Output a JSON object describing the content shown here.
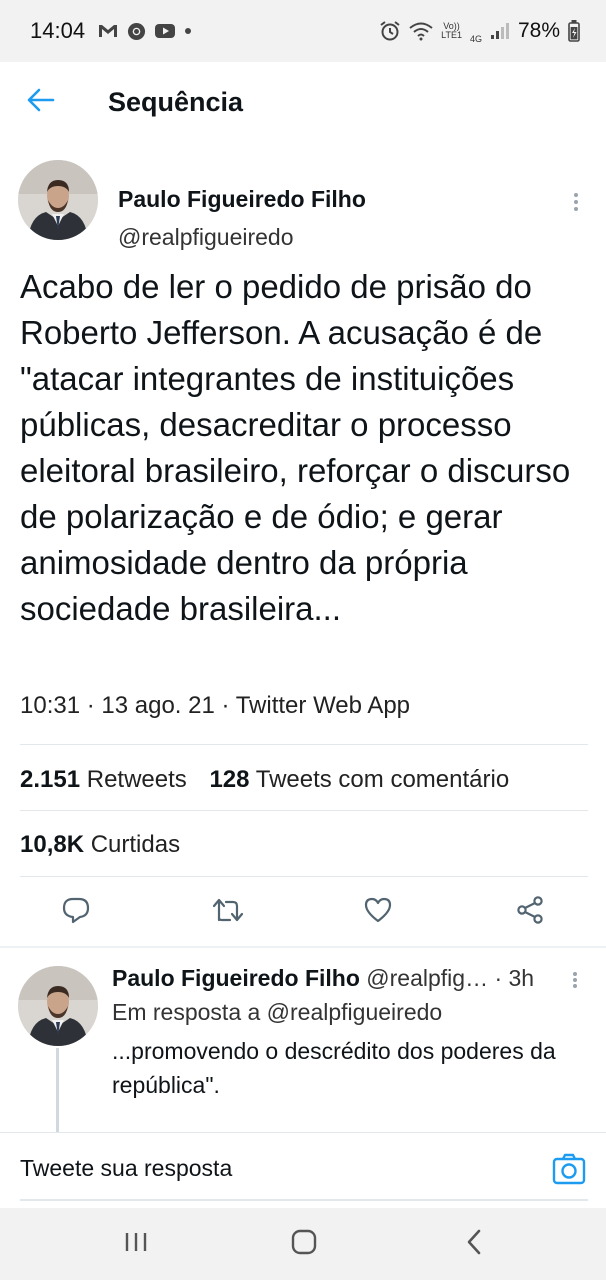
{
  "status_bar": {
    "time": "14:04",
    "network_label_top": "Vo))",
    "network_label_bottom": "LTE1",
    "network_type": "4G",
    "battery": "78%",
    "icons": [
      "gmail-icon",
      "chrome-icon",
      "youtube-icon",
      "dot-icon",
      "alarm-icon",
      "wifi-icon",
      "signal-icon",
      "battery-icon"
    ]
  },
  "header": {
    "title": "Sequência",
    "back_icon": "arrow-left-icon"
  },
  "tweet": {
    "author_name": "Paulo Figueiredo Filho",
    "author_handle": "@realpfigueiredo",
    "text": "Acabo de ler o pedido de prisão do Roberto Jefferson. A acusação é de \"atacar integrantes de instituições públicas, desacreditar o processo eleitoral brasileiro, reforçar o discurso de polarização e de ódio; e gerar animosidade dentro da própria sociedade brasileira...",
    "meta": "10:31 · 13 ago. 21 · Twitter Web App",
    "retweets_count": "2.151",
    "retweets_label": "Retweets",
    "quotes_count": "128",
    "quotes_label": "Tweets com comentário",
    "likes_count": "10,8K",
    "likes_label": "Curtidas",
    "actions": [
      "reply-icon",
      "retweet-icon",
      "like-icon",
      "share-icon"
    ]
  },
  "reply": {
    "author_name": "Paulo Figueiredo Filho",
    "author_handle": "@realpfig…",
    "time": "· 3h",
    "reply_to": "Em resposta a @realpfigueiredo",
    "text": "...promovendo o descrédito dos poderes da república\"."
  },
  "compose": {
    "placeholder": "Tweete sua resposta",
    "camera_icon": "camera-icon"
  },
  "nav": [
    "recent-apps-icon",
    "home-icon",
    "back-icon"
  ],
  "colors": {
    "accent": "#1d9bf0",
    "text": "#0f1419",
    "icon_gray": "#536471",
    "system_bar": "#f2f2f2"
  }
}
